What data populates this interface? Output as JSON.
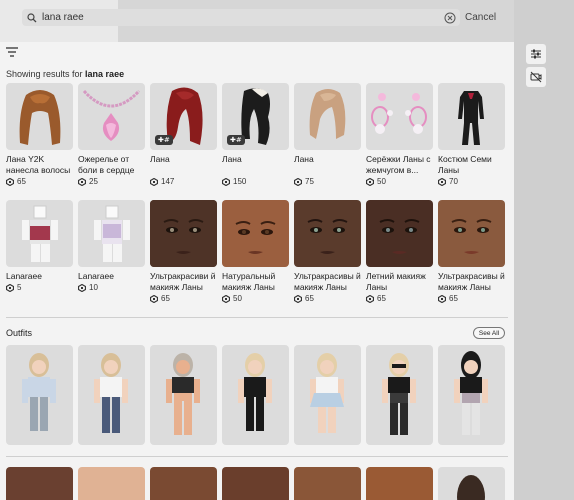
{
  "search": {
    "query": "lana raee",
    "cancel_label": "Cancel"
  },
  "results": {
    "prefix": "Showing results for ",
    "query": "lana raee"
  },
  "items_row1": [
    {
      "name": "Лана Y2K нанесла волосы",
      "price": "65",
      "badge": ""
    },
    {
      "name": "Ожерелье от боли в сердце",
      "price": "25",
      "badge": ""
    },
    {
      "name": "Лана",
      "price": "147",
      "badge": "✚#"
    },
    {
      "name": "Лана",
      "price": "150",
      "badge": "✚#"
    },
    {
      "name": "Лана",
      "price": "75",
      "badge": ""
    },
    {
      "name": "Серёжки Ланы с жемчугом в...",
      "price": "50",
      "badge": ""
    },
    {
      "name": "Костюм Семи Ланы",
      "price": "70",
      "badge": ""
    }
  ],
  "items_row2": [
    {
      "name": "Lanaraee",
      "price": "5"
    },
    {
      "name": "Lanaraee",
      "price": "10"
    },
    {
      "name": "Ультракрасиви й макияж Ланы",
      "price": "65"
    },
    {
      "name": "Натуральный макияж Ланы",
      "price": "50"
    },
    {
      "name": "Ультракрасивы й макияж Ланы",
      "price": "65"
    },
    {
      "name": "Летний макияж Ланы",
      "price": "65"
    },
    {
      "name": "Ультракрасивы й макияж Ланы",
      "price": "65"
    }
  ],
  "outfits": {
    "title": "Outfits",
    "see_all": "See All"
  },
  "colors": {
    "panel": "#f3f3f3",
    "thumb": "#dcdcdc",
    "accent_pink": "#e99bc8"
  }
}
